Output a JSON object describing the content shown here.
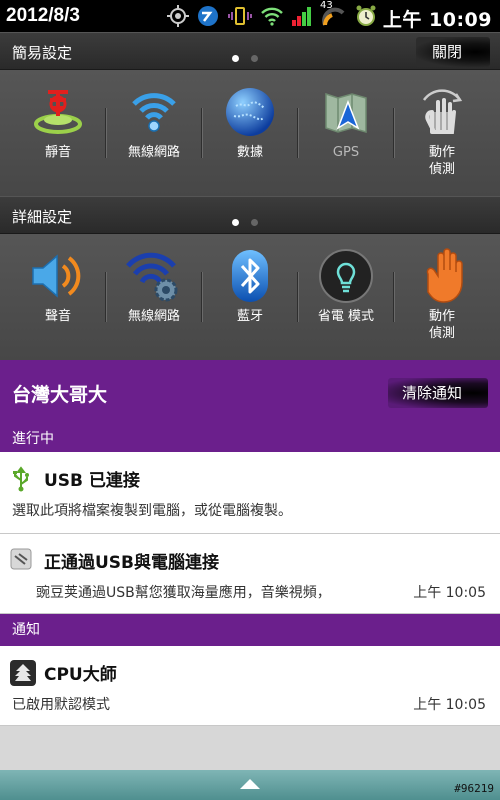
{
  "status_bar": {
    "date": "2012/8/3",
    "time": "上午 10:09",
    "battery_level": "43",
    "icons": [
      "gps-icon",
      "app-icon",
      "vibrate-icon",
      "wifi-icon",
      "signal-icon",
      "battery-icon",
      "alarm-icon"
    ]
  },
  "quick_settings": {
    "header": "簡易設定",
    "toggle_label": "關閉",
    "items": [
      {
        "label": "靜音",
        "icon": "silent-icon",
        "active": true
      },
      {
        "label": "無線網路",
        "icon": "wifi-icon",
        "active": true
      },
      {
        "label": "數據",
        "icon": "globe-icon",
        "active": true
      },
      {
        "label": "GPS",
        "icon": "gps-map-icon",
        "active": false
      },
      {
        "label": "動作\n偵測",
        "icon": "hand-gesture-icon",
        "active": true
      }
    ]
  },
  "detail_settings": {
    "header": "詳細設定",
    "items": [
      {
        "label": "聲音",
        "icon": "speaker-icon"
      },
      {
        "label": "無線網路",
        "icon": "wifi-settings-icon"
      },
      {
        "label": "藍牙",
        "icon": "bluetooth-icon"
      },
      {
        "label": "省電 模式",
        "icon": "lightbulb-icon"
      },
      {
        "label": "動作\n偵測",
        "icon": "hand-icon"
      }
    ]
  },
  "carrier": {
    "name": "台灣大哥大",
    "clear_label": "清除通知"
  },
  "ongoing": {
    "label": "進行中",
    "items": [
      {
        "title": "USB 已連接",
        "body": "選取此項將檔案複製到電腦，或從電腦複製。",
        "time": ""
      },
      {
        "title": "正通過USB與電腦連接",
        "body": "豌豆荚通過USB幫您獲取海量應用，音樂視頻，",
        "time": "上午 10:05"
      }
    ]
  },
  "notifications": {
    "label": "通知",
    "items": [
      {
        "title": "CPU大師",
        "body": "已啟用默認模式",
        "time": "上午 10:05"
      }
    ]
  },
  "watermark": "#96219",
  "colors": {
    "carrier_purple": "#6b1f8c",
    "panel_dark": "#4a4a4a",
    "handle_teal": "#5f9f9f"
  }
}
